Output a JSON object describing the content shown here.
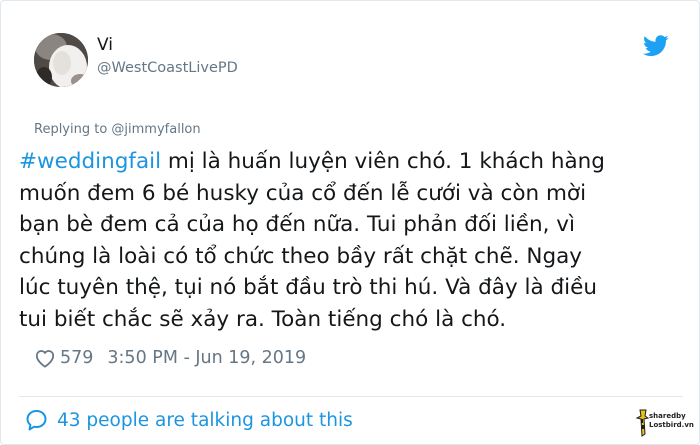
{
  "user": {
    "display_name": "Vi",
    "handle": "@WestCoastLivePD"
  },
  "reply_context": "Replying to @jimmyfallon",
  "tweet": {
    "hashtag": "#weddingfail",
    "lines": [
      " mị là huấn luyện viên chó. 1 khách hàng",
      "muốn đem 6 bé husky của cổ đến lễ cưới và còn mời",
      "bạn bè đem cả của họ đến nữa. Tui phản đối liền, vì",
      "chúng là loài có tổ chức theo bầy rất chặt chẽ. Ngay",
      "lúc tuyên thệ, tụi nó bắt đầu trò thi hú. Và đây là điều",
      "tui biết chắc sẽ xảy ra. Toàn tiếng chó là chó."
    ]
  },
  "meta": {
    "likes": "579",
    "timestamp": "3:50 PM - Jun 19, 2019"
  },
  "conversation": {
    "label": "43 people are talking about this"
  },
  "watermark": {
    "line1": "sharedby",
    "line2": "Lostbird.vn"
  },
  "icons": {
    "brand": "twitter-bird-icon",
    "like": "heart-icon",
    "reply": "speech-bubble-icon"
  },
  "colors": {
    "accent": "#1b95e0",
    "muted": "#657786",
    "text": "#14171a",
    "border": "#e1e8ed"
  }
}
